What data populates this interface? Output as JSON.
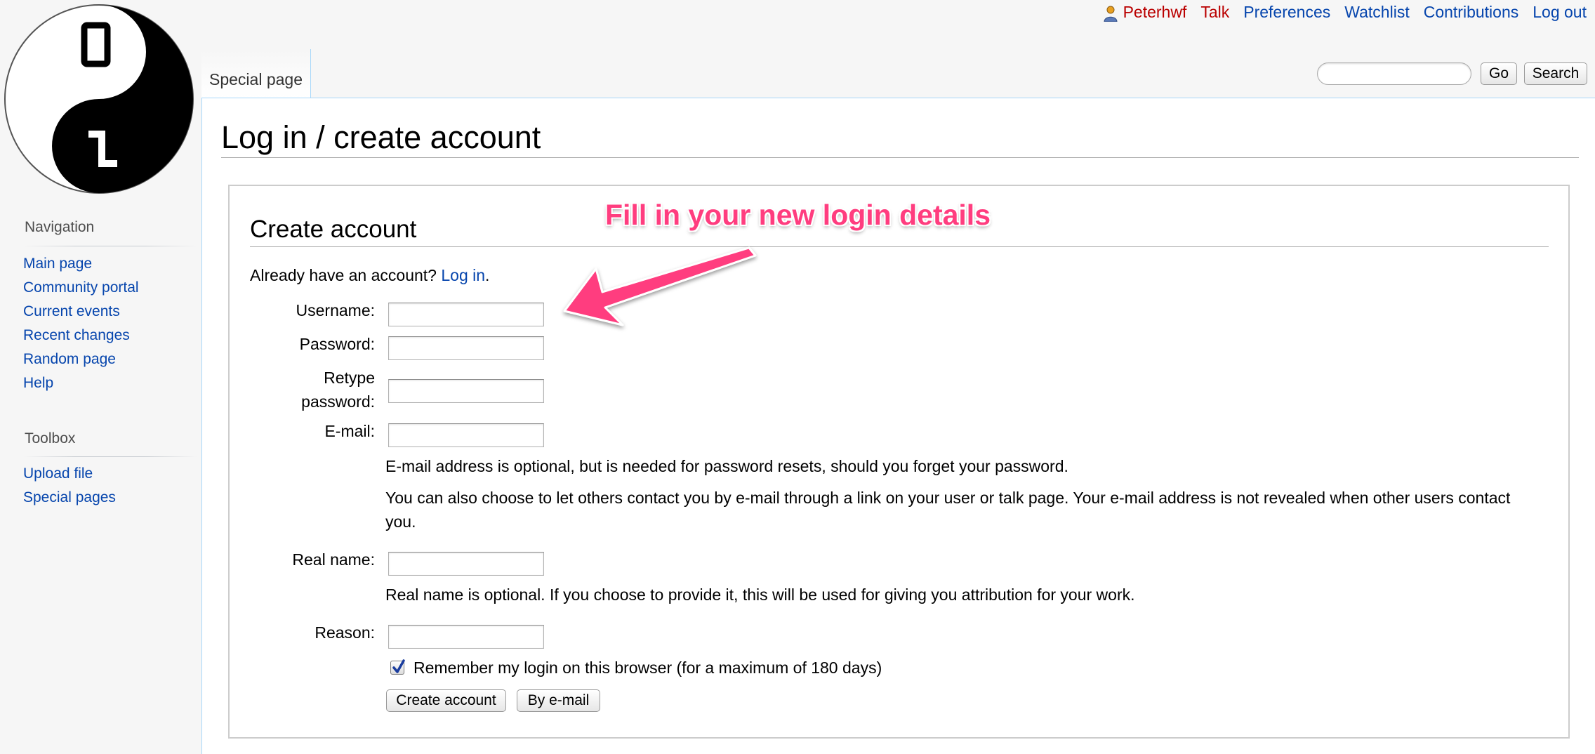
{
  "personal_tools": {
    "username": "Peterhwf",
    "talk": "Talk",
    "preferences": "Preferences",
    "watchlist": "Watchlist",
    "contributions": "Contributions",
    "logout": "Log out"
  },
  "tabs": {
    "special_page": "Special page"
  },
  "search": {
    "placeholder": "",
    "go_label": "Go",
    "search_label": "Search"
  },
  "page": {
    "title": "Log in / create account"
  },
  "sidebar": {
    "navigation": {
      "heading": "Navigation",
      "items": [
        {
          "label": "Main page"
        },
        {
          "label": "Community portal"
        },
        {
          "label": "Current events"
        },
        {
          "label": "Recent changes"
        },
        {
          "label": "Random page"
        },
        {
          "label": "Help"
        }
      ]
    },
    "toolbox": {
      "heading": "Toolbox",
      "items": [
        {
          "label": "Upload file"
        },
        {
          "label": "Special pages"
        }
      ]
    }
  },
  "form": {
    "heading": "Create account",
    "already_text": "Already have an account?",
    "login_link": "Log in",
    "login_period": ".",
    "username_label": "Username:",
    "username_value": "",
    "password_label": "Password:",
    "retype_label_1": "Retype",
    "retype_label_2": "password:",
    "email_label": "E-mail:",
    "email_help_1": "E-mail address is optional, but is needed for password resets, should you forget your password.",
    "email_help_2a": "You can also choose to let others contact you by e-mail through a link on your user or talk page. Your e-mail address is not revealed when other users contact",
    "email_help_2b": "you.",
    "realname_label": "Real name:",
    "realname_help": "Real name is optional. If you choose to provide it, this will be used for giving you attribution for your work.",
    "reason_label": "Reason:",
    "remember_label": "Remember my login on this browser (for a maximum of 180 days)",
    "remember_checked": true,
    "create_button": "Create account",
    "email_button": "By e-mail"
  },
  "annotation": {
    "text": "Fill in your new login details",
    "color": "#ff3d7f"
  },
  "colors": {
    "link": "#0645ad",
    "new_link": "#ba0000",
    "sidebar_bg": "#f6f6f6",
    "border_blue": "#a7d7f9"
  },
  "logo": {
    "description_icon": "yin-yang-binary-logo"
  }
}
